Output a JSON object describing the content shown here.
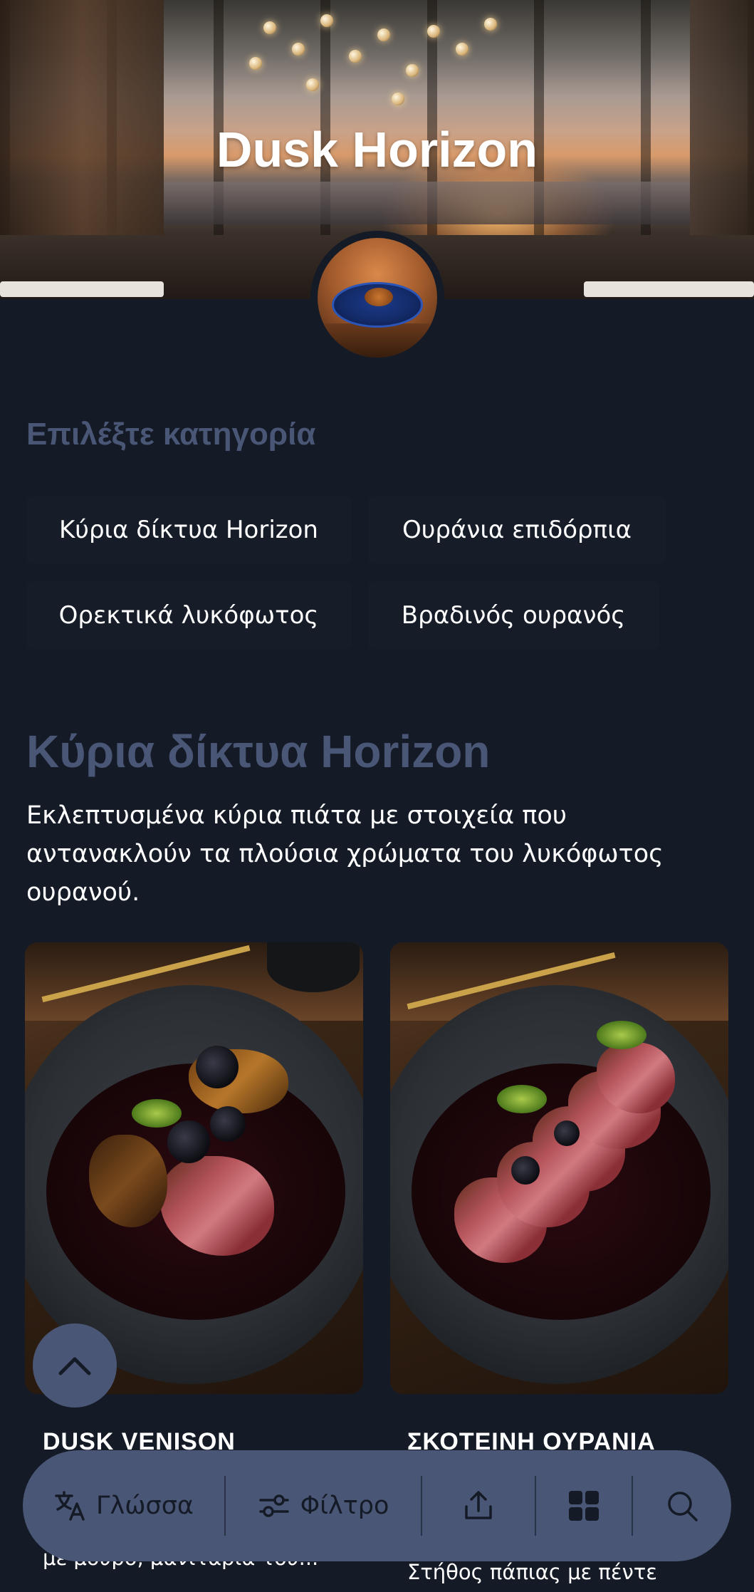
{
  "restaurant": {
    "name": "Dusk Horizon"
  },
  "categories": {
    "heading": "Επιλέξτε κατηγορία",
    "items": [
      {
        "label": "Κύρια δίκτυα Horizon"
      },
      {
        "label": "Ουράνια επιδόρπια"
      },
      {
        "label": "Ορεκτικά λυκόφωτος"
      },
      {
        "label": "Βραδινός ουρανός"
      }
    ]
  },
  "section": {
    "title": "Κύρια δίκτυα Horizon",
    "description": "Εκλεπτυσμένα κύρια πιάτα με στοιχεία που αντανακλούν τα πλούσια χρώματα του λυκόφωτος ουρανού."
  },
  "dishes": [
    {
      "name": "DUSK VENISON",
      "description": "με μούρο, μανιτάρια του..."
    },
    {
      "name": "ΣΚΟΤΕΙΝΗ ΟΥΡΑΝΙΑ",
      "description": "Στήθος πάπιας με πέντε"
    }
  ],
  "bottom_bar": {
    "language_label": "Γλώσσα",
    "filter_label": "Φίλτρο",
    "icons": [
      "translate-icon",
      "filter-icon",
      "share-icon",
      "grid-icon",
      "search-icon"
    ]
  },
  "colors": {
    "background": "#141a26",
    "accent": "#4a5675",
    "chip": "#161c28",
    "text": "#ffffff"
  }
}
